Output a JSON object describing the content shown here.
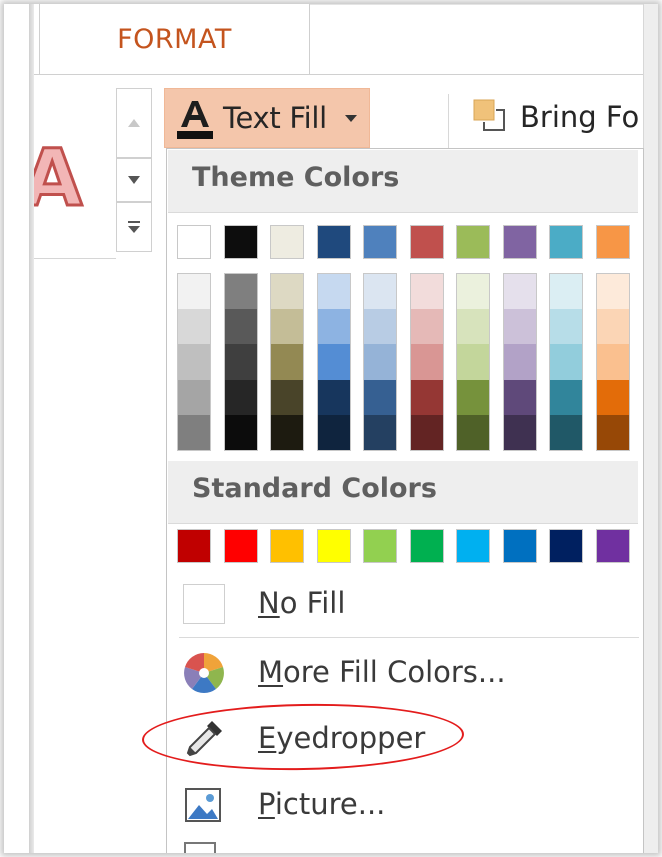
{
  "ribbon": {
    "tab_label": "FORMAT",
    "text_fill_label": "Text Fill",
    "bring_forward_label": "Bring Fo",
    "wordart_preview_letter": "A"
  },
  "dropdown": {
    "theme_header": "Theme Colors",
    "standard_header": "Standard Colors",
    "theme_colors": [
      "#ffffff",
      "#0d0d0d",
      "#eeece1",
      "#1f497d",
      "#4f81bd",
      "#c0504d",
      "#9bbb59",
      "#8064a2",
      "#4bacc6",
      "#f79646"
    ],
    "theme_shades": [
      [
        "#f2f2f2",
        "#d8d8d8",
        "#bfbfbf",
        "#a5a5a5",
        "#7f7f7f"
      ],
      [
        "#7f7f7f",
        "#595959",
        "#3f3f3f",
        "#262626",
        "#0c0c0c"
      ],
      [
        "#ddd9c3",
        "#c4bd97",
        "#938953",
        "#494429",
        "#1d1b10"
      ],
      [
        "#c6d9f0",
        "#8db3e2",
        "#548dd4",
        "#17365d",
        "#0f243e"
      ],
      [
        "#dbe5f1",
        "#b8cce4",
        "#95b3d7",
        "#366092",
        "#244061"
      ],
      [
        "#f2dcdb",
        "#e5b9b7",
        "#d99694",
        "#953734",
        "#632423"
      ],
      [
        "#ebf1dd",
        "#d7e3bc",
        "#c3d69b",
        "#76923c",
        "#4f6128"
      ],
      [
        "#e5e0ec",
        "#ccc1d9",
        "#b2a2c7",
        "#5f497a",
        "#3f3151"
      ],
      [
        "#dbeef3",
        "#b7dde8",
        "#92cddc",
        "#31859b",
        "#205867"
      ],
      [
        "#fdeada",
        "#fbd5b5",
        "#fac08f",
        "#e36c09",
        "#974806"
      ]
    ],
    "standard_colors": [
      "#c00000",
      "#ff0000",
      "#ffc000",
      "#ffff00",
      "#92d050",
      "#00b050",
      "#00b0f0",
      "#0070c0",
      "#002060",
      "#7030a0"
    ],
    "no_fill": {
      "mnemonic": "N",
      "rest": "o Fill"
    },
    "more_fill_colors": {
      "mnemonic": "M",
      "rest": "ore Fill Colors..."
    },
    "eyedropper": {
      "mnemonic": "E",
      "rest": "yedropper"
    },
    "picture": {
      "mnemonic": "P",
      "rest": "icture..."
    }
  },
  "colors": {
    "accent_tab_text": "#c4541e",
    "button_highlight": "#f4c6ab",
    "annotation_oval": "#e31c1c"
  }
}
